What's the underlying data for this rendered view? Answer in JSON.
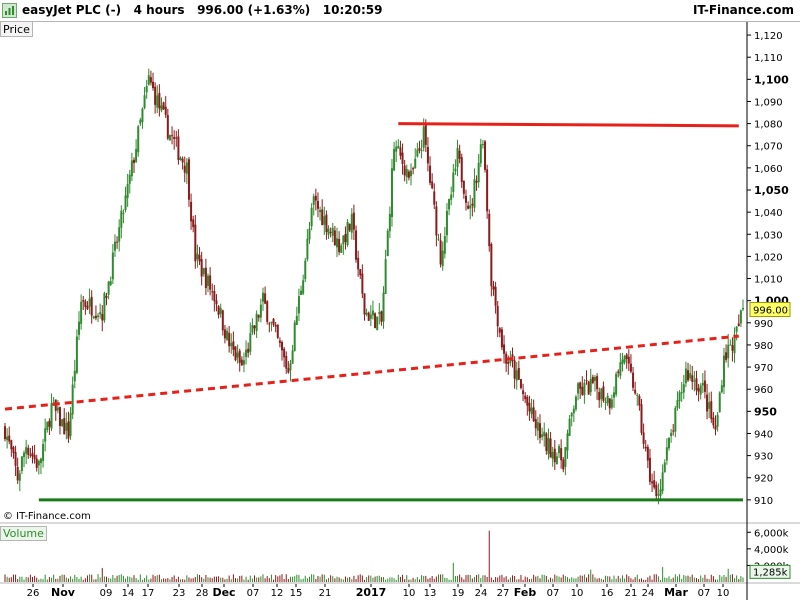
{
  "header": {
    "title": "easyJet PLC (-)   4 hours   996.00 (+1.63%)   10:20:59",
    "site": "IT-Finance.com"
  },
  "price_label": "Price",
  "volume_label": "Volume",
  "watermark": "© IT-Finance.com",
  "colors": {
    "up": "#2e8b2e",
    "down": "#8b1a1a",
    "resistance": "#e8201a",
    "support": "#1a7a1a",
    "trend": "#e8201a",
    "last_price_bg": "#ffff66"
  },
  "chart_data": {
    "type": "candlestick",
    "price_axis": {
      "ylim": [
        900,
        1125
      ],
      "ticks": [
        {
          "value": 910,
          "label": "910",
          "bold": false
        },
        {
          "value": 920,
          "label": "920",
          "bold": false
        },
        {
          "value": 930,
          "label": "930",
          "bold": false
        },
        {
          "value": 940,
          "label": "940",
          "bold": false
        },
        {
          "value": 950,
          "label": "950",
          "bold": true
        },
        {
          "value": 960,
          "label": "960",
          "bold": false
        },
        {
          "value": 970,
          "label": "970",
          "bold": false
        },
        {
          "value": 980,
          "label": "980",
          "bold": false
        },
        {
          "value": 990,
          "label": "990",
          "bold": false
        },
        {
          "value": 1000,
          "label": "1,000",
          "bold": true
        },
        {
          "value": 1010,
          "label": "1,010",
          "bold": false
        },
        {
          "value": 1020,
          "label": "1,020",
          "bold": false
        },
        {
          "value": 1030,
          "label": "1,030",
          "bold": false
        },
        {
          "value": 1040,
          "label": "1,040",
          "bold": false
        },
        {
          "value": 1050,
          "label": "1,050",
          "bold": true
        },
        {
          "value": 1060,
          "label": "1,060",
          "bold": false
        },
        {
          "value": 1070,
          "label": "1,070",
          "bold": false
        },
        {
          "value": 1080,
          "label": "1,080",
          "bold": false
        },
        {
          "value": 1090,
          "label": "1,090",
          "bold": false
        },
        {
          "value": 1100,
          "label": "1,100",
          "bold": true
        },
        {
          "value": 1110,
          "label": "1,110",
          "bold": false
        },
        {
          "value": 1120,
          "label": "1,120",
          "bold": false
        }
      ]
    },
    "volume_axis": {
      "ylim": [
        0,
        7000
      ],
      "ticks": [
        {
          "value": 6000,
          "label": "6,000k"
        },
        {
          "value": 4000,
          "label": "4,000k"
        },
        {
          "value": 2000,
          "label": "2,000k"
        }
      ],
      "last_label": "1,285k",
      "last_value": 1285
    },
    "last_price": {
      "value": 996.0,
      "label": "996.00"
    },
    "x_axis": [
      {
        "label": "26",
        "bold": false
      },
      {
        "label": "Nov",
        "bold": true
      },
      {
        "label": "09",
        "bold": false
      },
      {
        "label": "14",
        "bold": false
      },
      {
        "label": "17",
        "bold": false
      },
      {
        "label": "23",
        "bold": false
      },
      {
        "label": "28",
        "bold": false
      },
      {
        "label": "Dec",
        "bold": true
      },
      {
        "label": "07",
        "bold": false
      },
      {
        "label": "12",
        "bold": false
      },
      {
        "label": "15",
        "bold": false
      },
      {
        "label": "21",
        "bold": false
      },
      {
        "label": "2017",
        "bold": true
      },
      {
        "label": "10",
        "bold": false
      },
      {
        "label": "13",
        "bold": false
      },
      {
        "label": "19",
        "bold": false
      },
      {
        "label": "24",
        "bold": false
      },
      {
        "label": "27",
        "bold": false
      },
      {
        "label": "Feb",
        "bold": true
      },
      {
        "label": "07",
        "bold": false
      },
      {
        "label": "10",
        "bold": false
      },
      {
        "label": "16",
        "bold": false
      },
      {
        "label": "21",
        "bold": false
      },
      {
        "label": "24",
        "bold": false
      },
      {
        "label": "Mar",
        "bold": true
      },
      {
        "label": "07",
        "bold": false
      },
      {
        "label": "10",
        "bold": false
      }
    ],
    "trendlines": [
      {
        "name": "resistance",
        "style": "solid",
        "from": {
          "bar": 186,
          "value": 1080
        },
        "to": {
          "bar": 347,
          "value": 1079
        }
      },
      {
        "name": "support",
        "style": "solid",
        "from": {
          "bar": 16,
          "value": 910
        },
        "to": {
          "bar": 349,
          "value": 910
        }
      },
      {
        "name": "rising-trend",
        "style": "dashed",
        "from": {
          "bar": 0,
          "value": 951
        },
        "to": {
          "bar": 347,
          "value": 984
        }
      }
    ],
    "series_keypoints": [
      {
        "bar": 0,
        "value": 942
      },
      {
        "bar": 6,
        "value": 920
      },
      {
        "bar": 10,
        "value": 935
      },
      {
        "bar": 16,
        "value": 925
      },
      {
        "bar": 22,
        "value": 952
      },
      {
        "bar": 30,
        "value": 940
      },
      {
        "bar": 36,
        "value": 1000
      },
      {
        "bar": 46,
        "value": 995
      },
      {
        "bar": 58,
        "value": 1050
      },
      {
        "bar": 68,
        "value": 1100
      },
      {
        "bar": 78,
        "value": 1075
      },
      {
        "bar": 86,
        "value": 1060
      },
      {
        "bar": 90,
        "value": 1020
      },
      {
        "bar": 100,
        "value": 1000
      },
      {
        "bar": 106,
        "value": 980
      },
      {
        "bar": 112,
        "value": 970
      },
      {
        "bar": 122,
        "value": 1000
      },
      {
        "bar": 134,
        "value": 968
      },
      {
        "bar": 146,
        "value": 1045
      },
      {
        "bar": 158,
        "value": 1025
      },
      {
        "bar": 164,
        "value": 1035
      },
      {
        "bar": 170,
        "value": 995
      },
      {
        "bar": 178,
        "value": 990
      },
      {
        "bar": 184,
        "value": 1070
      },
      {
        "bar": 192,
        "value": 1055
      },
      {
        "bar": 198,
        "value": 1075
      },
      {
        "bar": 206,
        "value": 1020
      },
      {
        "bar": 214,
        "value": 1065
      },
      {
        "bar": 220,
        "value": 1040
      },
      {
        "bar": 226,
        "value": 1075
      },
      {
        "bar": 230,
        "value": 1010
      },
      {
        "bar": 236,
        "value": 975
      },
      {
        "bar": 240,
        "value": 970
      },
      {
        "bar": 250,
        "value": 945
      },
      {
        "bar": 256,
        "value": 935
      },
      {
        "bar": 264,
        "value": 928
      },
      {
        "bar": 270,
        "value": 958
      },
      {
        "bar": 278,
        "value": 962
      },
      {
        "bar": 286,
        "value": 955
      },
      {
        "bar": 292,
        "value": 975
      },
      {
        "bar": 298,
        "value": 960
      },
      {
        "bar": 304,
        "value": 925
      },
      {
        "bar": 308,
        "value": 910
      },
      {
        "bar": 314,
        "value": 935
      },
      {
        "bar": 322,
        "value": 968
      },
      {
        "bar": 330,
        "value": 960
      },
      {
        "bar": 336,
        "value": 940
      },
      {
        "bar": 340,
        "value": 975
      },
      {
        "bar": 345,
        "value": 982
      },
      {
        "bar": 349,
        "value": 996
      }
    ],
    "bar_count": 350,
    "volume_spikes": [
      {
        "bar": 0,
        "value": 900
      },
      {
        "bar": 229,
        "value": 6200
      },
      {
        "bar": 46,
        "value": 1700
      },
      {
        "bar": 212,
        "value": 2300
      },
      {
        "bar": 277,
        "value": 1500
      },
      {
        "bar": 311,
        "value": 1800
      },
      {
        "bar": 342,
        "value": 1600
      }
    ]
  }
}
